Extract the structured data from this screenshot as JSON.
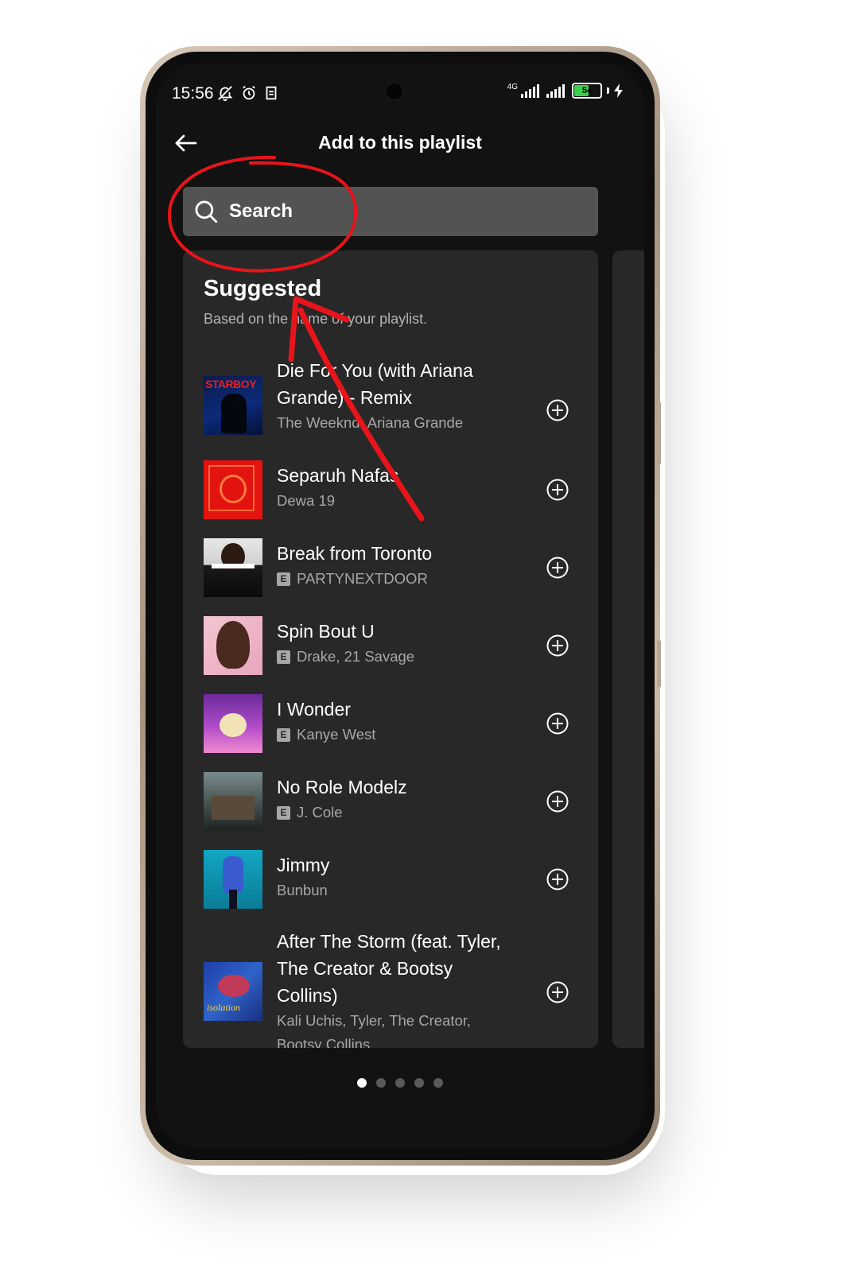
{
  "status_bar": {
    "time": "15:56",
    "network": "4G",
    "battery": "54"
  },
  "header": {
    "title": "Add to this playlist"
  },
  "search": {
    "label": "Search"
  },
  "suggested": {
    "title": "Suggested",
    "subtitle": "Based on the name of your playlist.",
    "tracks": [
      {
        "title": "Die For You (with Ariana Grande) - Remix",
        "artist": "The Weeknd, Ariana Grande",
        "explicit": false,
        "cover_text": "STARBOY"
      },
      {
        "title": "Separuh Nafas",
        "artist": "Dewa 19",
        "explicit": false
      },
      {
        "title": "Break from Toronto",
        "artist": "PARTYNEXTDOOR",
        "explicit": true
      },
      {
        "title": "Spin Bout U",
        "artist": "Drake, 21 Savage",
        "explicit": true
      },
      {
        "title": "I Wonder",
        "artist": "Kanye West",
        "explicit": true
      },
      {
        "title": "No Role Modelz",
        "artist": "J. Cole",
        "explicit": true
      },
      {
        "title": "Jimmy",
        "artist": "Bunbun",
        "explicit": false
      },
      {
        "title": "After The Storm (feat. Tyler, The Creator & Bootsy Collins)",
        "artist": "Kali Uchis, Tyler, The Creator, Bootsy Collins",
        "explicit": false,
        "cover_text": "isolation"
      }
    ]
  },
  "explicit_badge": "E",
  "pager": {
    "count": 5,
    "active": 0
  },
  "colors": {
    "background": "#121212",
    "card": "#282828",
    "search": "#535353",
    "secondary_text": "#a7a7a7",
    "annotation": "#e8141b"
  }
}
